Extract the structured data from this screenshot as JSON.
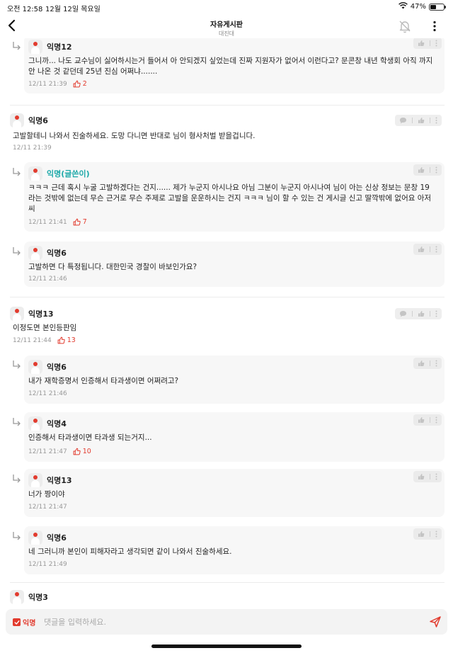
{
  "status_bar": {
    "time": "오전 12:58",
    "date": "12월 12일 목요일",
    "battery_text": "47%",
    "battery_level": 0.47
  },
  "header": {
    "title": "자유게시판",
    "subtitle": "대진대"
  },
  "comments": [
    {
      "nick": "익명12",
      "text": "그니까... 나도 교수님이 싫어하시는거 들어서 아 안되겠지 싶었는데 진짜 지원자가 없어서 이런다고? 문콘창 내년 학생회 아직 까지 안 나온 것 같던데 25년 진심 어쩌냐.......",
      "time": "12/11 21:39",
      "likes": "2"
    },
    {
      "nick": "익명6",
      "text": "고발할테니 나와서 진술하세요. 도망 다니면 반대로 님이 형사처벌 받을겁니다.",
      "time": "12/11 21:39"
    },
    {
      "nick": "익명(글쓴이)",
      "text": "ㅋㅋㅋ 근데 혹시 누굴 고발하겠다는 건지...... 제가 누군지 아시나요 아님 그분이 누군지 아시나여 님이 아는 신상 정보는 문창 19라는 것밖에 없는데 무슨 근거로 무슨 주제로 고발을 운운하시는 건지 ㅋㅋㅋ 님이 할 수 있는 건 게시글 신고 딸깍밖에 없어요 아저씨",
      "time": "12/11 21:41",
      "likes": "7"
    },
    {
      "nick": "익명6",
      "text": "고발하면 다 특정됩니다. 대한민국 경찰이 바보인가요?",
      "time": "12/11 21:46"
    },
    {
      "nick": "익명13",
      "text": "이정도면 본인등판임",
      "time": "12/11 21:44",
      "likes": "13"
    },
    {
      "nick": "익명6",
      "text": "내가 재학증명서 인증해서 타과생이면 어쩌려고?",
      "time": "12/11 21:46"
    },
    {
      "nick": "익명4",
      "text": "인증해서 타과생이면 타과생 되는거지...",
      "time": "12/11 21:47",
      "likes": "10"
    },
    {
      "nick": "익명13",
      "text": "너가 짱이야",
      "time": "12/11 21:47"
    },
    {
      "nick": "익명6",
      "text": "네 그러니까 본인이 피해자라고 생각되면 같이 나와서 진술하세요.",
      "time": "12/11 21:49"
    },
    {
      "nick": "익명3"
    }
  ],
  "input_bar": {
    "anon_label": "익명",
    "placeholder": "댓글을 입력하세요."
  },
  "colors": {
    "accent": "#e23b2e",
    "author_nick": "#1aa8a8",
    "reply_bg": "#f7f7f7"
  }
}
